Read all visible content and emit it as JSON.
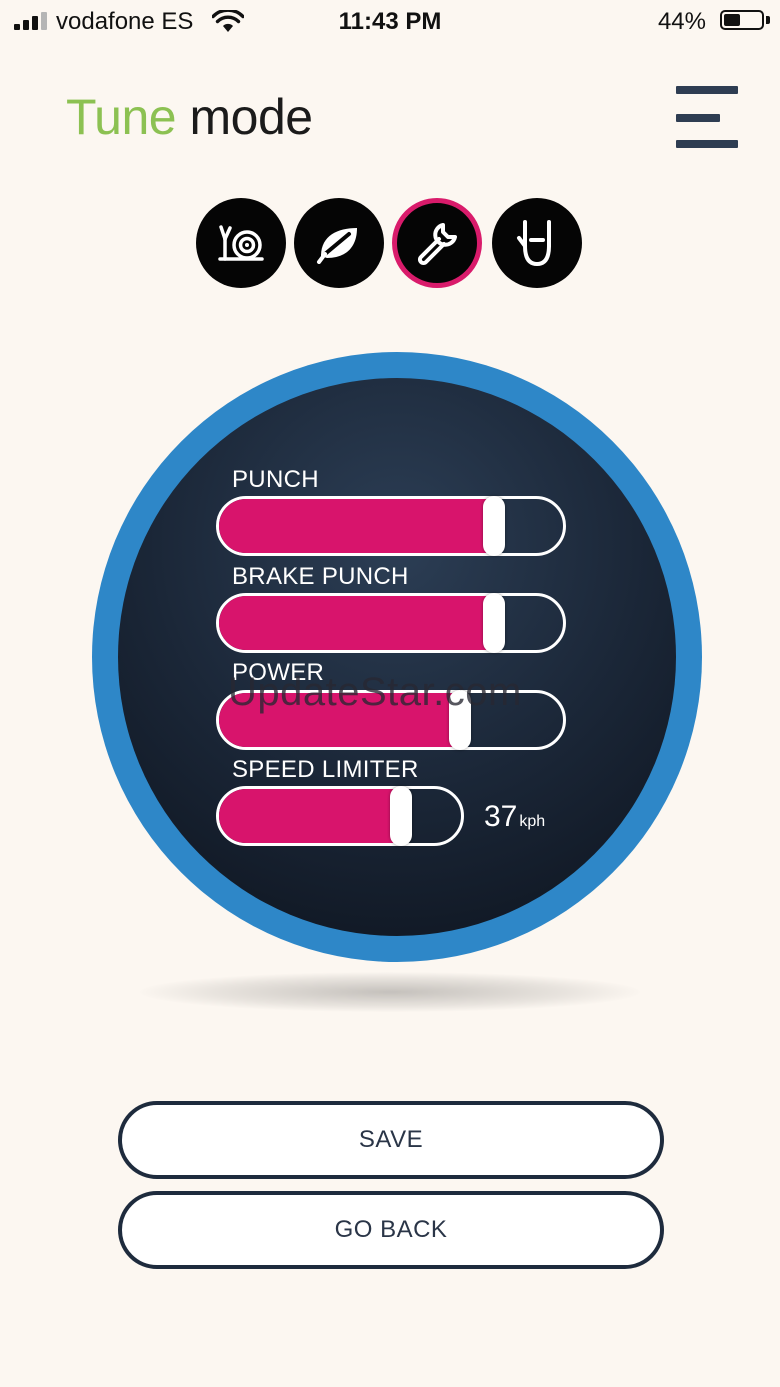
{
  "status_bar": {
    "carrier": "vodafone ES",
    "time": "11:43 PM",
    "battery_percent": "44%",
    "battery_level": 0.44,
    "signal_bars": 3,
    "signal_bars_total": 4
  },
  "header": {
    "title_part1": "Tune",
    "title_part2": "mode",
    "title_part1_color": "#8cc152",
    "menu_icon": "hamburger-menu-icon"
  },
  "modes": [
    {
      "id": "snail",
      "icon": "snail-icon",
      "active": false
    },
    {
      "id": "eco",
      "icon": "leaf-icon",
      "active": false
    },
    {
      "id": "tune",
      "icon": "wrench-icon",
      "active": true
    },
    {
      "id": "rock",
      "icon": "rock-hand-icon",
      "active": false
    }
  ],
  "sliders": [
    {
      "label": "PUNCH",
      "value": 0.8
    },
    {
      "label": "BRAKE PUNCH",
      "value": 0.8
    },
    {
      "label": "POWER",
      "value": 0.7
    },
    {
      "label": "SPEED LIMITER",
      "value": 0.75
    }
  ],
  "speed_readout": {
    "value": "37",
    "unit": "kph"
  },
  "watermark": "UpdateStar.com",
  "buttons": {
    "save": "SAVE",
    "go_back": "GO BACK"
  },
  "colors": {
    "accent_pink": "#d8146c",
    "ring_blue": "#2e87c8",
    "dark_navy": "#1e2b3d",
    "background": "#fcf7f1"
  }
}
